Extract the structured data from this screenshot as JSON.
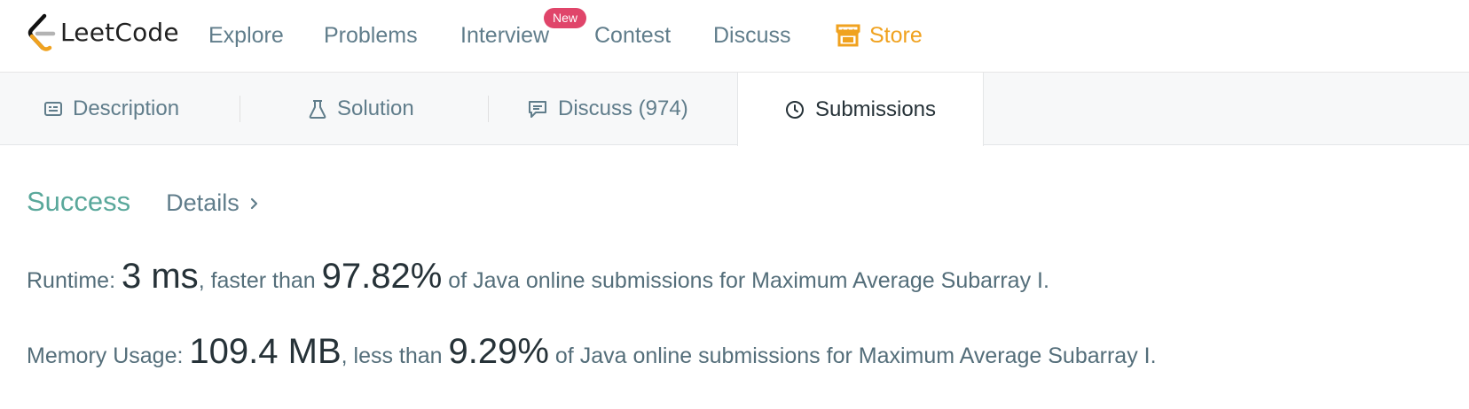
{
  "nav": {
    "logo_text": "LeetCode",
    "items": {
      "explore": "Explore",
      "problems": "Problems",
      "interview": "Interview",
      "contest": "Contest",
      "discuss": "Discuss",
      "store": "Store"
    },
    "new_badge": "New"
  },
  "tabs": {
    "description": "Description",
    "solution": "Solution",
    "discuss": "Discuss (974)",
    "submissions": "Submissions"
  },
  "result": {
    "status": "Success",
    "details_link": "Details",
    "runtime_label": "Runtime:",
    "runtime_value": "3 ms",
    "runtime_mid": ", faster than",
    "runtime_percent": "97.82%",
    "runtime_tail": "of Java online submissions for Maximum Average Subarray I.",
    "memory_label": "Memory Usage:",
    "memory_value": "109.4 MB",
    "memory_mid": ", less than",
    "memory_percent": "9.29%",
    "memory_tail": "of Java online submissions for Maximum Average Subarray I."
  },
  "colors": {
    "success": "#5aa89b",
    "store": "#f0a21f",
    "badge": "#e0456a"
  }
}
